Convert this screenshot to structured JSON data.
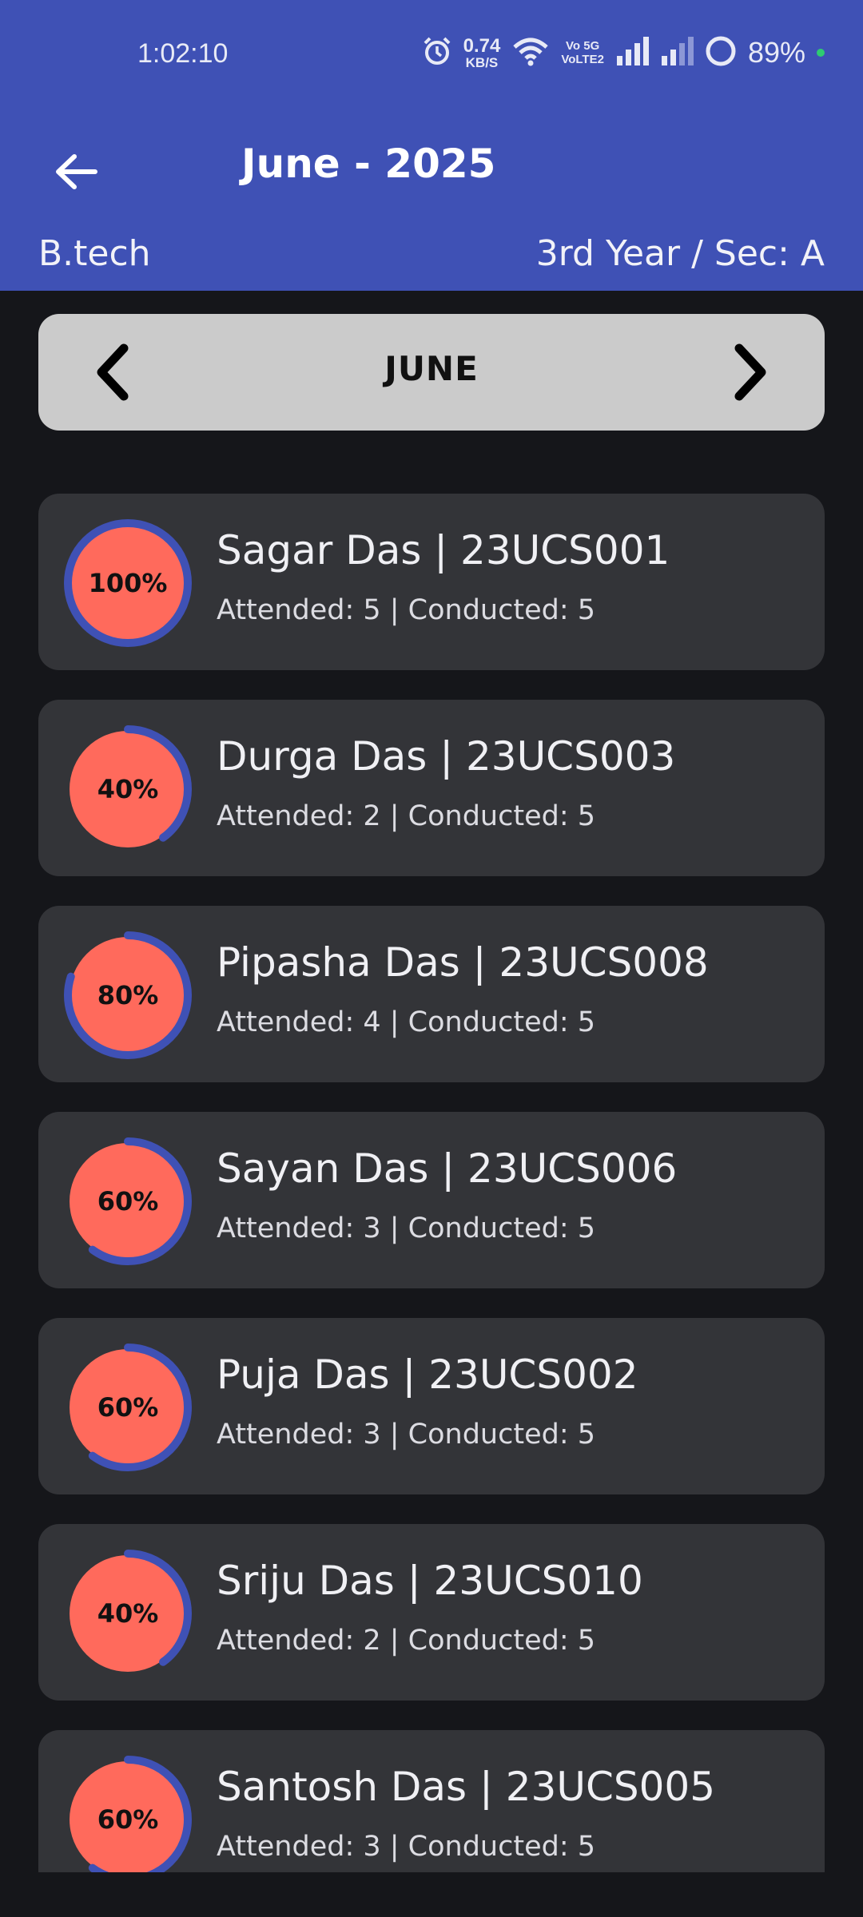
{
  "status_bar": {
    "time": "1:02:10",
    "speed_value": "0.74",
    "speed_unit": "KB/S",
    "network_label": "Vo 5G\nVoLTE2",
    "battery": "89%"
  },
  "header": {
    "title": "June - 2025",
    "course": "B.tech",
    "section": "3rd Year / Sec: A"
  },
  "month_selector": {
    "label": "JUNE"
  },
  "colors": {
    "accent": "#3f51b5",
    "ring_fill": "#ff6a5c",
    "card_bg": "#333438",
    "page_bg": "#15161a",
    "selector_bg": "#cbcbcb"
  },
  "students": [
    {
      "percent_label": "100%",
      "percent": 100,
      "name": "Sagar Das | 23UCS001",
      "stats": "Attended: 5 | Conducted: 5"
    },
    {
      "percent_label": "40%",
      "percent": 40,
      "name": "Durga Das | 23UCS003",
      "stats": "Attended: 2 | Conducted: 5"
    },
    {
      "percent_label": "80%",
      "percent": 80,
      "name": "Pipasha Das | 23UCS008",
      "stats": "Attended: 4 | Conducted: 5"
    },
    {
      "percent_label": "60%",
      "percent": 60,
      "name": "Sayan Das | 23UCS006",
      "stats": "Attended: 3 | Conducted: 5"
    },
    {
      "percent_label": "60%",
      "percent": 60,
      "name": "Puja Das | 23UCS002",
      "stats": "Attended: 3 | Conducted: 5"
    },
    {
      "percent_label": "40%",
      "percent": 40,
      "name": "Sriju Das | 23UCS010",
      "stats": "Attended: 2 | Conducted: 5"
    },
    {
      "percent_label": "60%",
      "percent": 60,
      "name": "Santosh Das | 23UCS005",
      "stats": "Attended: 3 | Conducted: 5"
    }
  ]
}
